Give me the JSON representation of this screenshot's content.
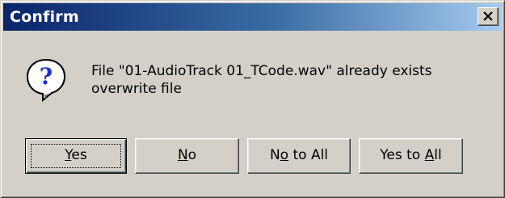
{
  "window": {
    "title": "Confirm",
    "close_icon": "close-icon"
  },
  "dialog": {
    "icon": "question-icon",
    "message_line1": "File \"01-AudioTrack 01_TCode.wav\" already exists",
    "message_line2": "overwrite file"
  },
  "buttons": {
    "yes": {
      "pre": "",
      "accel": "Y",
      "post": "es"
    },
    "no": {
      "pre": "",
      "accel": "N",
      "post": "o"
    },
    "no_to_all": {
      "pre": "N",
      "accel": "o",
      "post": " to All"
    },
    "yes_to_all": {
      "pre": "Yes to ",
      "accel": "A",
      "post": "ll"
    }
  },
  "colors": {
    "face": "#d4d0c8",
    "title_start": "#0a246a",
    "title_end": "#a6caf0",
    "icon_blue": "#1c2fd0"
  }
}
